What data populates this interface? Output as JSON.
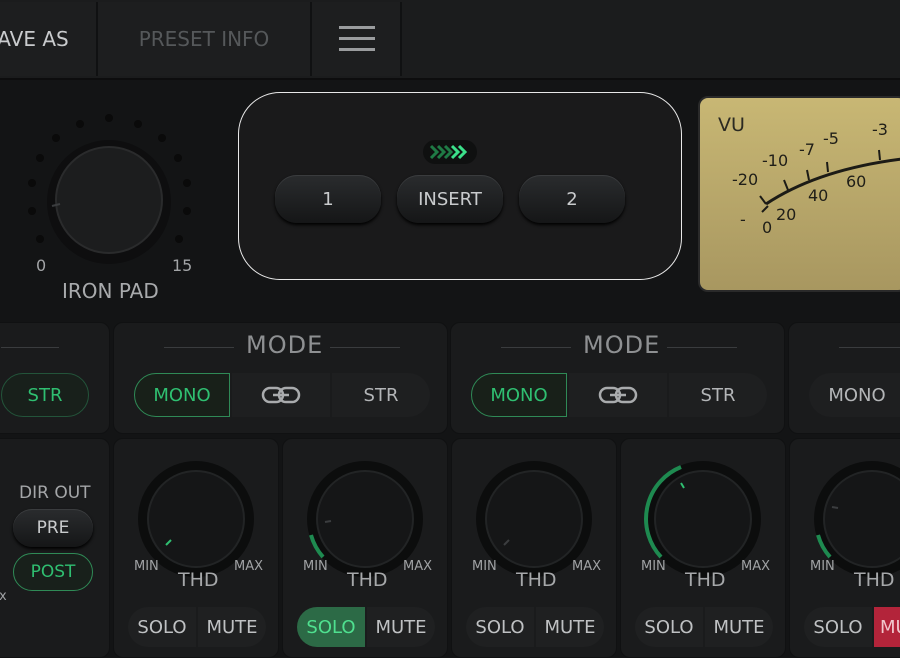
{
  "topbar": {
    "save_as": "AVE AS",
    "preset_info": "PRESET INFO"
  },
  "iron_pad": {
    "label": "IRON PAD",
    "min": "0",
    "max": "15"
  },
  "routing": {
    "btn1": "1",
    "insert": "INSERT",
    "btn2": "2"
  },
  "vu": {
    "title": "VU",
    "scale_top": [
      "-20",
      "-10",
      "-7",
      "-5",
      "-3"
    ],
    "scale_bottom": [
      "-",
      "0",
      "20",
      "40",
      "60"
    ]
  },
  "modes": [
    {
      "heading": "",
      "str": "STR"
    },
    {
      "heading": "MODE",
      "mono": "MONO",
      "str": "STR"
    },
    {
      "heading": "MODE",
      "mono": "MONO",
      "str": "STR"
    },
    {
      "heading": "",
      "mono": "MONO"
    }
  ],
  "dir_out": {
    "label": "DIR OUT",
    "pre": "PRE",
    "post": "POST",
    "edge": "x"
  },
  "channels": [
    {
      "min": "MIN",
      "max": "MAX",
      "knob": "THD",
      "solo": "SOLO",
      "mute": "MUTE",
      "solo_active": false,
      "mute_active": false
    },
    {
      "min": "MIN",
      "max": "MAX",
      "knob": "THD",
      "solo": "SOLO",
      "mute": "MUTE",
      "solo_active": true,
      "mute_active": false
    },
    {
      "min": "MIN",
      "max": "MAX",
      "knob": "THD",
      "solo": "SOLO",
      "mute": "MUTE",
      "solo_active": false,
      "mute_active": false
    },
    {
      "min": "MIN",
      "max": "MAX",
      "knob": "THD",
      "solo": "SOLO",
      "mute": "MUTE",
      "solo_active": false,
      "mute_active": false
    },
    {
      "min": "MIN",
      "max": "",
      "knob": "THD",
      "solo": "SOLO",
      "mute": "MU",
      "solo_active": false,
      "mute_active": true
    }
  ],
  "colors": {
    "accent_green": "#2fbf71",
    "mute_red": "#c8283c",
    "vu_face": "#cdbd7c"
  }
}
